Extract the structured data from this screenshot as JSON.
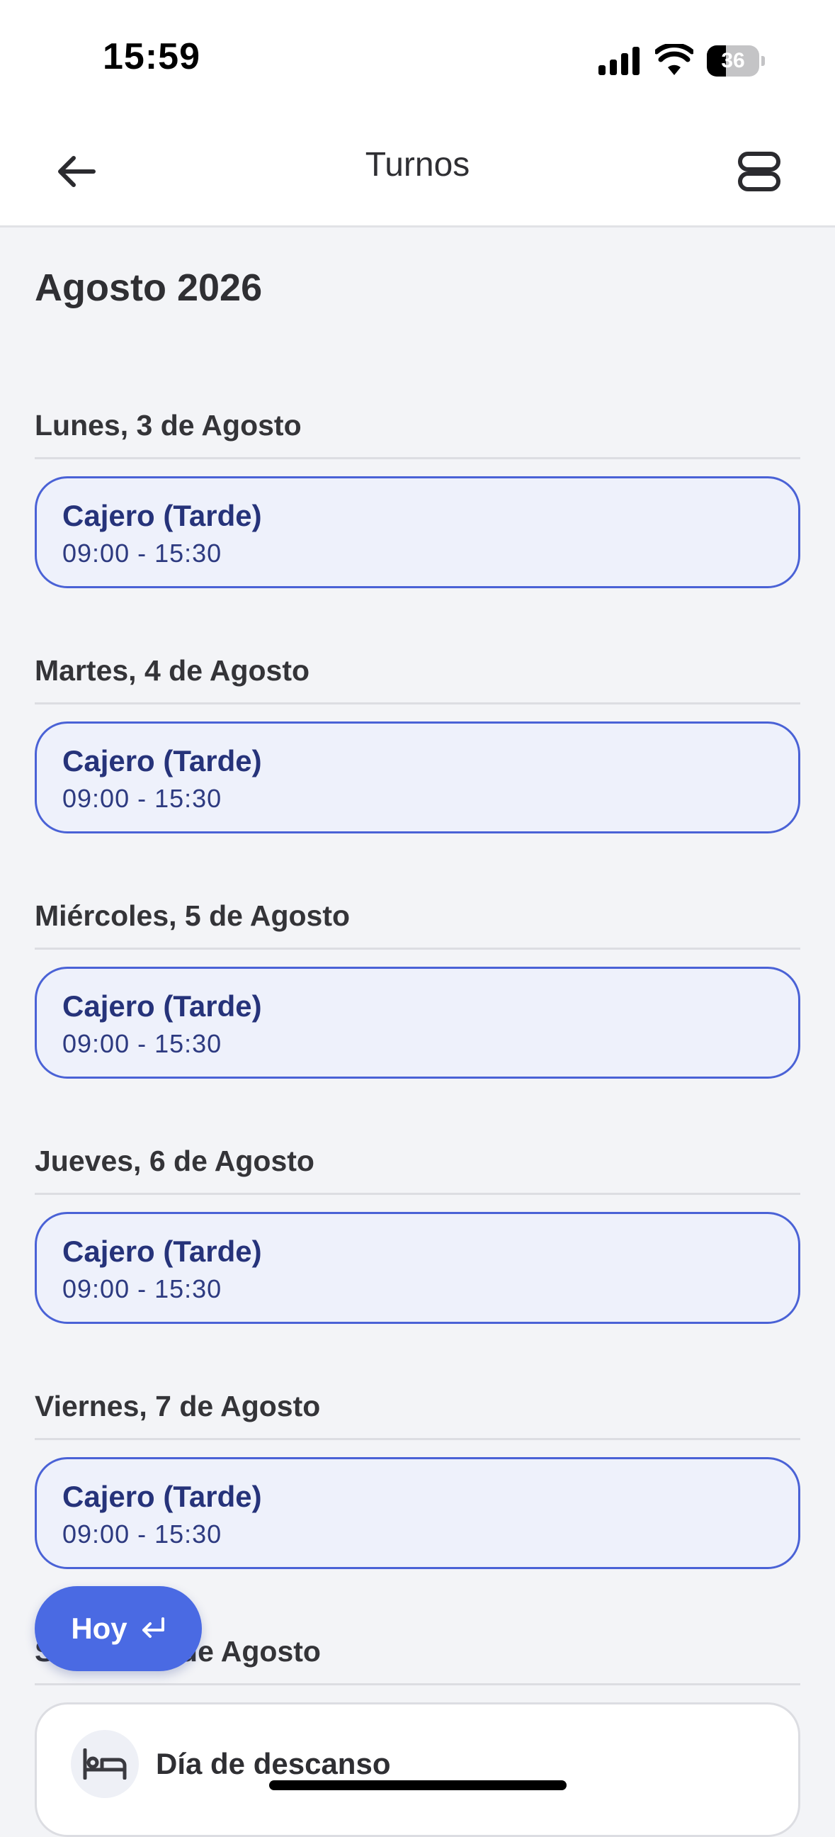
{
  "status_bar": {
    "time": "15:59",
    "battery": "36",
    "icons": [
      "signal-icon",
      "wifi-icon",
      "battery-icon"
    ]
  },
  "app_bar": {
    "title": "Turnos",
    "back_icon": "arrow-left-icon",
    "view_icon": "view-toggle-icon"
  },
  "month": "Agosto 2026",
  "days": [
    {
      "date": "Lunes, 3 de Agosto",
      "shift": {
        "name": "Cajero (Tarde)",
        "hours": "09:00 - 15:30"
      }
    },
    {
      "date": "Martes, 4 de Agosto",
      "shift": {
        "name": "Cajero (Tarde)",
        "hours": "09:00 - 15:30"
      }
    },
    {
      "date": "Miércoles, 5 de Agosto",
      "shift": {
        "name": "Cajero (Tarde)",
        "hours": "09:00 - 15:30"
      }
    },
    {
      "date": "Jueves, 6 de Agosto",
      "shift": {
        "name": "Cajero (Tarde)",
        "hours": "09:00 - 15:30"
      }
    },
    {
      "date": "Viernes, 7 de Agosto",
      "shift": {
        "name": "Cajero (Tarde)",
        "hours": "09:00 - 15:30"
      }
    },
    {
      "date": "Sábado, 8 de Agosto",
      "rest": {
        "label": "Día de descanso",
        "icon": "bed-icon"
      }
    }
  ],
  "today_button": {
    "label": "Hoy",
    "icon": "return-arrow-icon"
  },
  "colors": {
    "accent": "#4a6ae3",
    "card_border": "#4a62d6",
    "card_background": "#eef1fb",
    "shift_text": "#26337a",
    "page_background": "#f3f4f7"
  }
}
